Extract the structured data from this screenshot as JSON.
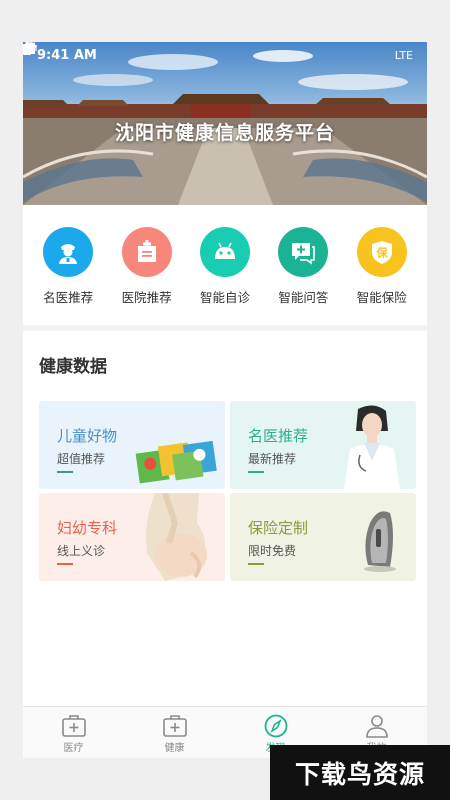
{
  "status_bar": {
    "time": "9:41 AM",
    "network": "LTE"
  },
  "banner": {
    "title": "沈阳市健康信息服务平台"
  },
  "quick_entries": [
    {
      "label": "名医推荐",
      "icon": "doctor-icon",
      "color": "#1ba9ec"
    },
    {
      "label": "医院推荐",
      "icon": "hospital-icon",
      "color": "#f7877b"
    },
    {
      "label": "智能自诊",
      "icon": "android-robot-icon",
      "color": "#18cdb2"
    },
    {
      "label": "智能问答",
      "icon": "chat-add-icon",
      "color": "#1ab394"
    },
    {
      "label": "智能保险",
      "icon": "shield-icon",
      "color": "#f8c21f"
    }
  ],
  "health_section": {
    "title": "健康数据",
    "cards": [
      {
        "title": "儿童好物",
        "subtitle": "超值推荐",
        "title_color": "#4a8fc8",
        "bg": "#e8f3fb",
        "bar_color": "#3c9a8a"
      },
      {
        "title": "名医推荐",
        "subtitle": "最新推荐",
        "title_color": "#2eae8f",
        "bg": "#e5f5f1",
        "bar_color": "#2eae8f"
      },
      {
        "title": "妇幼专科",
        "subtitle": "线上义诊",
        "title_color": "#e8624c",
        "bg": "#fdeeea",
        "bar_color": "#e8624c"
      },
      {
        "title": "保险定制",
        "subtitle": "限时免费",
        "title_color": "#8a9a3c",
        "bg": "#f0f2e4",
        "bar_color": "#8a9a3c"
      }
    ]
  },
  "tabbar": [
    {
      "label": "医疗",
      "icon": "medical-box-icon",
      "active": false
    },
    {
      "label": "健康",
      "icon": "health-box-icon",
      "active": false
    },
    {
      "label": "发现",
      "icon": "compass-icon",
      "active": true
    },
    {
      "label": "我的",
      "icon": "user-icon",
      "active": false
    }
  ],
  "watermark": {
    "text": "下载鸟资源"
  }
}
